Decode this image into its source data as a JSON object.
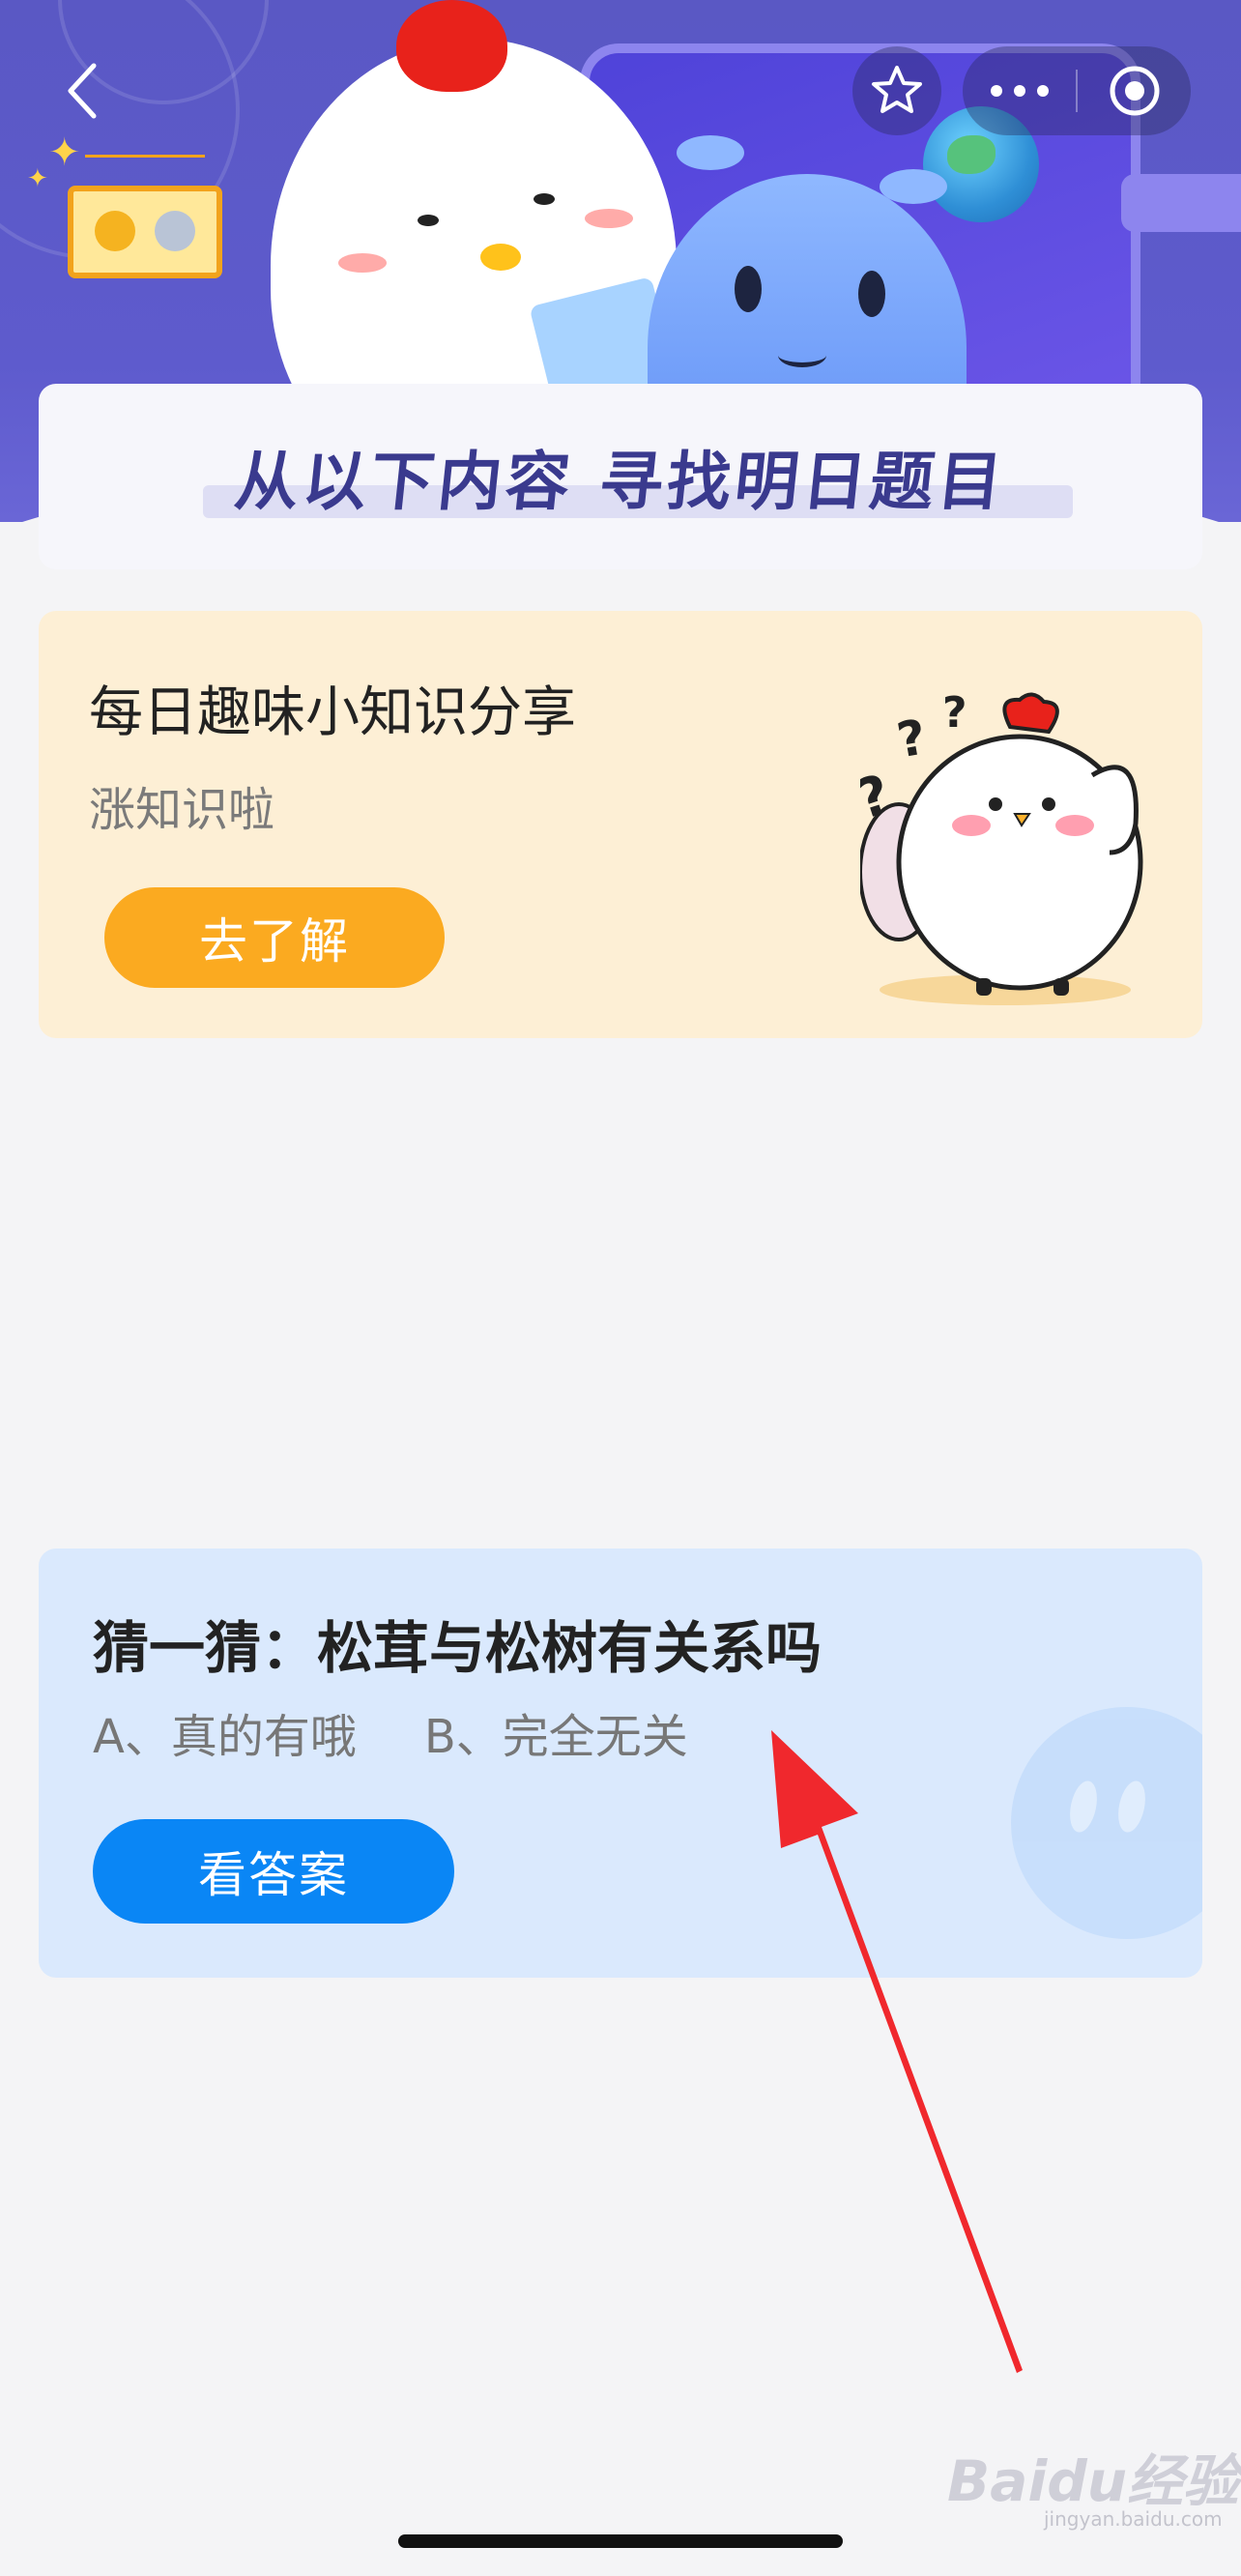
{
  "header": {
    "banner_title": "从以下内容  寻找明日题目",
    "back_icon": "chevron-left-icon",
    "favorite_icon": "star-icon",
    "more_icon": "more-dots-icon",
    "close_icon": "target-circle-icon"
  },
  "fun_card": {
    "title": "每日趣味小知识分享",
    "subtitle": "涨知识啦",
    "button_label": "去了解",
    "accent_color": "#fbaa20"
  },
  "quiz_card": {
    "question": "猜一猜：松茸与松树有关系吗",
    "options": [
      "A、真的有哦",
      "B、完全无关"
    ],
    "button_label": "看答案",
    "accent_color": "#0a86f5"
  },
  "overlay": {
    "arrow_color": "#f0282d"
  },
  "watermark": {
    "brand": "Baidu经验",
    "url": "jingyan.baidu.com"
  }
}
